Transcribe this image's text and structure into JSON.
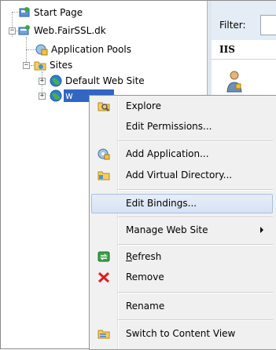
{
  "tree": {
    "start_page": "Start Page",
    "server": "Web.FairSSL.dk",
    "app_pools": "Application Pools",
    "sites": "Sites",
    "default_site": "Default Web Site",
    "selected_site": "w"
  },
  "right_pane": {
    "filter_label": "Filter:",
    "section_title": "IIS"
  },
  "context_menu": {
    "items": [
      {
        "label": "Explore"
      },
      {
        "label": "Edit Permissions..."
      },
      {
        "label": "Add Application..."
      },
      {
        "label": "Add Virtual Directory..."
      },
      {
        "label": "Edit Bindings..."
      },
      {
        "label": "Manage Web Site"
      },
      {
        "label_prefix": "",
        "label_underlined": "R",
        "label_suffix": "efresh"
      },
      {
        "label": "Remove"
      },
      {
        "label": "Rename"
      },
      {
        "label": "Switch to Content View"
      }
    ]
  }
}
